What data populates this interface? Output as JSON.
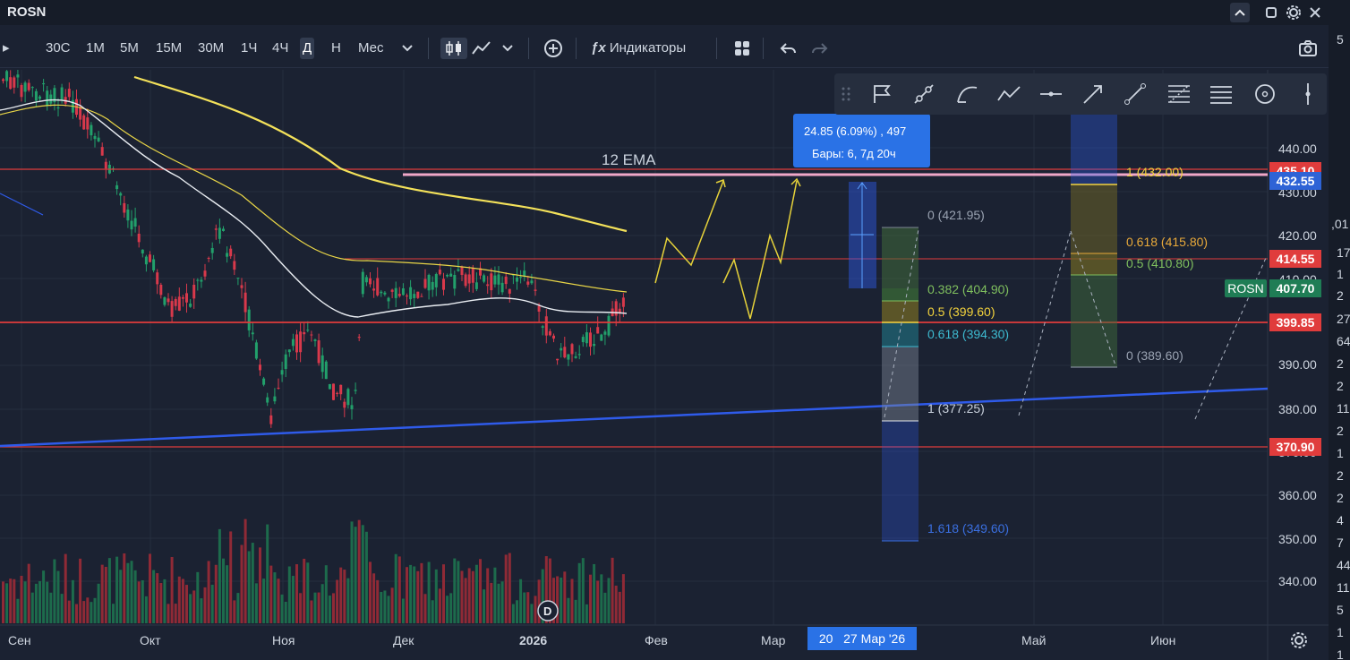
{
  "window": {
    "symbol": "ROSN",
    "controls": [
      "chevron-up",
      "maximize",
      "settings",
      "close"
    ]
  },
  "toolbar": {
    "timeframes": [
      "30С",
      "1М",
      "5М",
      "15М",
      "30М",
      "1Ч",
      "4Ч",
      "Д",
      "Н",
      "Мес"
    ],
    "active_timeframe": "Д",
    "indicators_label": "Индикаторы"
  },
  "chart": {
    "ema_label": "12 EMA",
    "measure_label_line1": "24.85 (6.09%) , 497",
    "measure_label_line2": "Бары: 6, 7д 20ч",
    "series_tag": "ROSN",
    "price_axis_labels": [
      "440.00",
      "430.00",
      "420.00",
      "410.00",
      "390.00",
      "380.00",
      "370.00",
      "360.00",
      "350.00",
      "340.00"
    ],
    "price_tags": [
      {
        "value": "435.10",
        "color": "#e03c3c"
      },
      {
        "value": "432.55",
        "color": "#2e63d6"
      },
      {
        "value": "414.55",
        "color": "#e03c3c"
      },
      {
        "value": "407.70",
        "color": "#1f7d55"
      },
      {
        "value": "399.85",
        "color": "#e03c3c"
      },
      {
        "value": "370.90",
        "color": "#e03c3c"
      }
    ],
    "time_labels": [
      "Сен",
      "Окт",
      "Ноя",
      "Дек",
      "2026",
      "Фев",
      "Мар",
      "Май",
      "Июн"
    ],
    "time_highlight": "20   27 Мар '26",
    "volume_badge": "D",
    "fib1_levels": [
      {
        "label": "0 (421.95)",
        "color": "#9aa3b2"
      },
      {
        "label": "0.382 (404.90)",
        "color": "#7fbf5e"
      },
      {
        "label": "0.5 (399.60)",
        "color": "#f2d23c"
      },
      {
        "label": "0.618 (394.30)",
        "color": "#3dbad0"
      },
      {
        "label": "1 (377.25)",
        "color": "#c9d1dc"
      },
      {
        "label": "1.618 (349.60)",
        "color": "#3a6fe0"
      }
    ],
    "fib2_levels": [
      {
        "label": "1 (432.00)",
        "color": "#f2d23c"
      },
      {
        "label": "0.618 (415.80)",
        "color": "#e8a93a"
      },
      {
        "label": "0.5 (410.80)",
        "color": "#7fbf5e"
      },
      {
        "label": "0 (389.60)",
        "color": "#9aa3b2"
      }
    ]
  },
  "drawing_tools": [
    "drag-handle",
    "flag",
    "ray",
    "curve",
    "polyline",
    "horizontal-line",
    "arrow",
    "trend-line",
    "fib-retracement",
    "parallel-channel",
    "circle",
    "vertical-line"
  ],
  "right_strip": [
    "17",
    "1",
    "2",
    "27",
    "64",
    "2",
    "2",
    "11",
    "2",
    "1",
    "2",
    "2",
    "4",
    "7",
    "44",
    "11",
    "5",
    "1",
    "1"
  ],
  "right_strip_top": [
    "5",
    ",01"
  ]
}
